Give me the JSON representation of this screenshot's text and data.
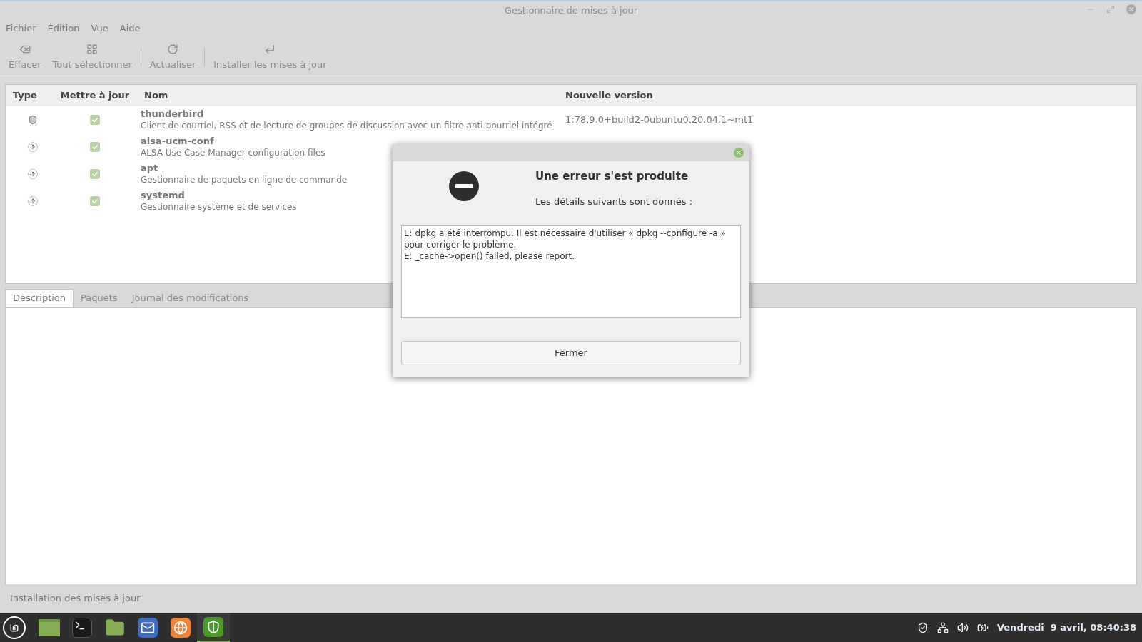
{
  "window": {
    "title": "Gestionnaire de mises à jour"
  },
  "menu": [
    "Fichier",
    "Édition",
    "Vue",
    "Aide"
  ],
  "toolbar": [
    {
      "kind": "clear",
      "label": "Effacer"
    },
    {
      "kind": "select-all",
      "label": "Tout sélectionner"
    },
    {
      "kind": "refresh",
      "label": "Actualiser"
    },
    {
      "kind": "install",
      "label": "Installer les mises à jour"
    }
  ],
  "table": {
    "columns": [
      "Type",
      "Mettre à jour",
      "Nom",
      "Nouvelle version"
    ],
    "rows": [
      {
        "kind": "security",
        "checked": true,
        "name": "thunderbird",
        "description": "Client de courriel, RSS et de lecture de groupes de discussion avec un filtre anti-pourriel intégré",
        "version": "1:78.9.0+build2-0ubuntu0.20.04.1~mt1"
      },
      {
        "kind": "package",
        "checked": true,
        "name": "alsa-ucm-conf",
        "description": "ALSA Use Case Manager configuration files"
      },
      {
        "kind": "package",
        "checked": true,
        "name": "apt",
        "description": "Gestionnaire de paquets en ligne de commande"
      },
      {
        "kind": "package",
        "checked": true,
        "name": "systemd",
        "description": "Gestionnaire système et de services"
      }
    ]
  },
  "tabs": [
    {
      "label": "Description",
      "selected": true
    },
    {
      "label": "Paquets",
      "selected": false
    },
    {
      "label": "Journal des modifications",
      "selected": false
    }
  ],
  "status_bar": "Installation des mises à jour",
  "dialog": {
    "title": "Une erreur s'est produite",
    "subtitle": "Les détails suivants sont donnés :",
    "details": [
      "E: dpkg a été interrompu. Il est nécessaire d'utiliser « dpkg --configure -a » pour corriger le problème.",
      "E: _cache->open() failed, please report."
    ],
    "button": "Fermer"
  },
  "taskbar": {
    "apps": [
      {
        "kind": "desktop",
        "selected": false
      },
      {
        "kind": "terminal",
        "selected": false
      },
      {
        "kind": "files",
        "selected": false
      },
      {
        "kind": "mail",
        "selected": false
      },
      {
        "kind": "browser",
        "selected": false
      },
      {
        "kind": "shield",
        "selected": true
      }
    ],
    "clock": "Vendredi  9 avril, 08:40:38"
  }
}
